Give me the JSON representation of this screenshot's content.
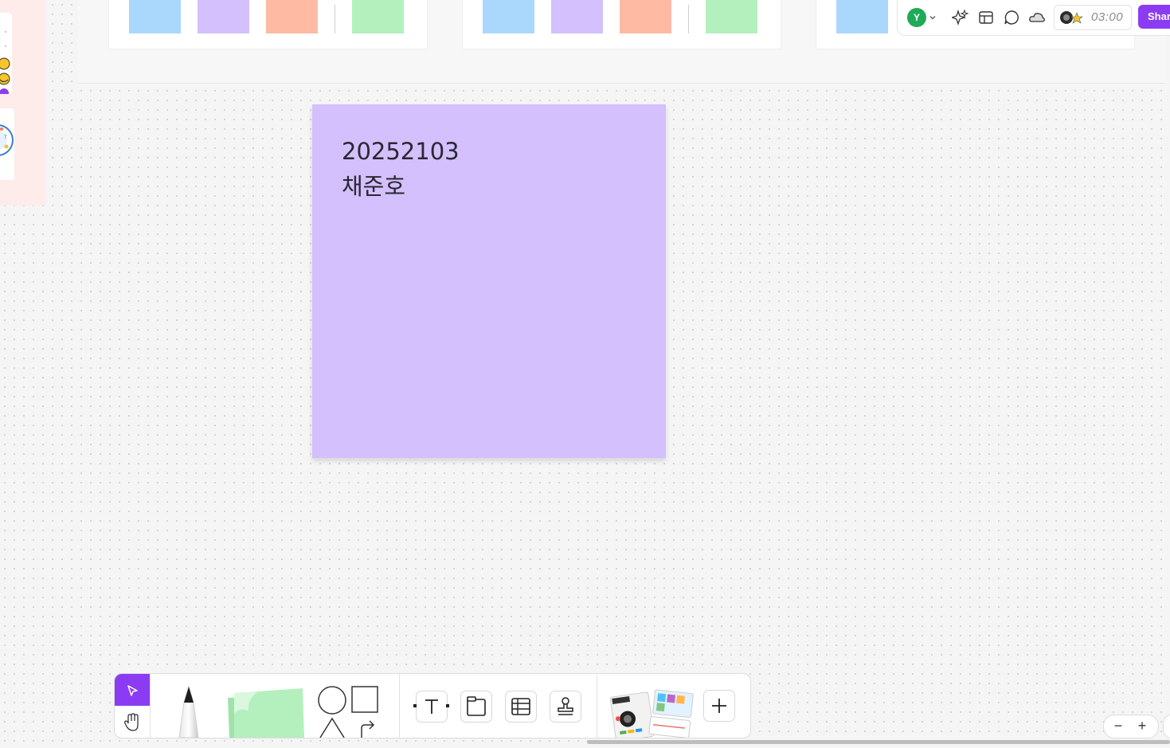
{
  "sticky_note": {
    "line1": "20252103",
    "line2": "채준호",
    "color": "#d3c0fd"
  },
  "template_swatch_colors": [
    "#aad8fd",
    "#d3c0fd",
    "#ffbaa3",
    "#b4f0bd"
  ],
  "top_toolbar": {
    "avatar_initial": "Y",
    "timer": "03:00",
    "share_label": "Share",
    "icons": [
      "sparkle-icon",
      "layout-icon",
      "comment-icon",
      "cloud-icon"
    ]
  },
  "bottom_toolbar": {
    "tools": [
      "select-tool",
      "hand-tool",
      "pen-tool",
      "sticky-note-tool",
      "shapes-tool",
      "text-tool",
      "section-tool",
      "table-tool",
      "stamp-tool",
      "templates-tool",
      "add-tool"
    ]
  },
  "zoom": {
    "minus": "−",
    "plus": "+"
  },
  "accent_color": "#8b3cf2"
}
